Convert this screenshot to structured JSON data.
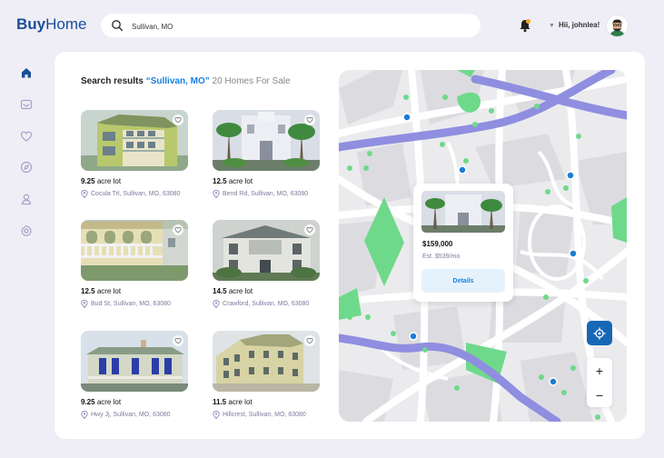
{
  "app": {
    "brand_bold": "Buy",
    "brand_light": "Home"
  },
  "search": {
    "value": "Sullivan, MO"
  },
  "user": {
    "greeting": "Hii, johnlea!"
  },
  "sidebar": {
    "items": [
      {
        "icon": "home-icon",
        "active": true
      },
      {
        "icon": "mail-icon",
        "active": false
      },
      {
        "icon": "heart-icon",
        "active": false
      },
      {
        "icon": "compass-icon",
        "active": false
      },
      {
        "icon": "user-icon",
        "active": false
      },
      {
        "icon": "gear-icon",
        "active": false
      }
    ]
  },
  "results": {
    "label": "Search results",
    "query": "“Sullivan, MO”",
    "count": "20 Homes For Sale"
  },
  "listings": [
    {
      "lot_value": "9.25",
      "lot_unit": "acre lot",
      "address": "Cocula Trl, Sullivan, MO, 63080"
    },
    {
      "lot_value": "12.5",
      "lot_unit": "acre lot",
      "address": "Bend Rd, Sullivan, MO, 63080"
    },
    {
      "lot_value": "12.5",
      "lot_unit": "acre lot",
      "address": "Bud St, Sullivan, MO, 63080"
    },
    {
      "lot_value": "14.5",
      "lot_unit": "acre lot",
      "address": "Crawford, Sullivan, MO, 63080"
    },
    {
      "lot_value": "9.25",
      "lot_unit": "acre lot",
      "address": "Hwy Jj, Sullivan, MO, 63080"
    },
    {
      "lot_value": "11.5",
      "lot_unit": "acre lot",
      "address": "Hillcrest, Sullivan, MO, 63080"
    }
  ],
  "map": {
    "popup": {
      "price": "$159,000",
      "estimate": "Est. $539/mo",
      "details_label": "Details"
    },
    "zoom_in_label": "+",
    "zoom_out_label": "−"
  },
  "colors": {
    "accent": "#1580e6",
    "brand": "#1a4e9a",
    "route": "#8f8ee0",
    "park": "#6fd98b",
    "marker": "#1a7bd6"
  }
}
